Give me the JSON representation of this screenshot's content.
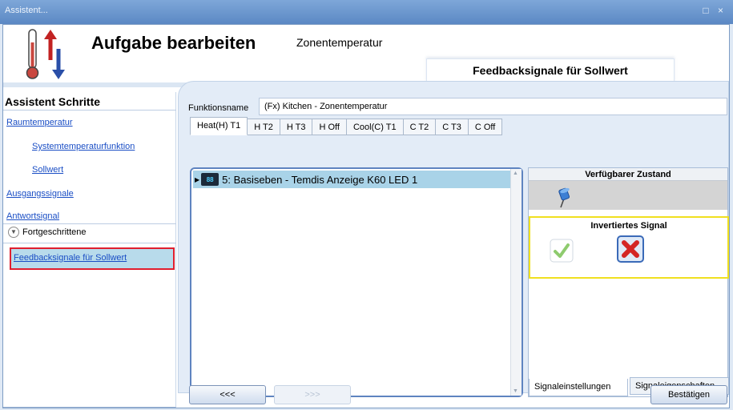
{
  "window": {
    "title": "Assistent...",
    "controls": "□ ×"
  },
  "header": {
    "title": "Aufgabe bearbeiten",
    "subtitle": "Zonentemperatur",
    "current_step": "Feedbacksignale für Sollwert"
  },
  "sidebar": {
    "title": "Assistent Schritte",
    "items": [
      {
        "label": "Raumtemperatur"
      },
      {
        "label": "Systemtemperaturfunktion"
      },
      {
        "label": "Sollwert"
      },
      {
        "label": "Ausgangssignale"
      },
      {
        "label": "Antwortsignal"
      }
    ],
    "advanced_label": "Fortgeschrittene",
    "selected_item": "Feedbacksignale für Sollwert"
  },
  "main": {
    "function_name_label": "Funktionsname",
    "function_name_value": "(Fx) Kitchen - Zonentemperatur",
    "tabs": [
      "Heat(H) T1",
      "H T2",
      "H T3",
      "H Off",
      "Cool(C) T1",
      "C T2",
      "C T3",
      "C Off"
    ],
    "active_tab": "Heat(H) T1",
    "tree": [
      {
        "label": "5: Basiseben - Temdis Anzeige K60 LED 1",
        "icon": "led-display-icon",
        "icon_text": "88"
      }
    ]
  },
  "signal_panel": {
    "available_state_header": "Verfügbarer Zustand",
    "inverted_signal_header": "Invertiertes Signal",
    "tabs": [
      "Signaleinstellungen",
      "Signaleigenschaften"
    ],
    "active_tab": "Signaleinstellungen",
    "highlight_color": "#f0e020"
  },
  "footer": {
    "back_label": "<<<",
    "next_label": ">>>",
    "confirm_label": "Bestätigen"
  },
  "colors": {
    "titlebar": "#6b97cf",
    "selection_border": "#e01f2f",
    "link": "#1a4ec5",
    "tree_selection": "#a9d3e8"
  }
}
